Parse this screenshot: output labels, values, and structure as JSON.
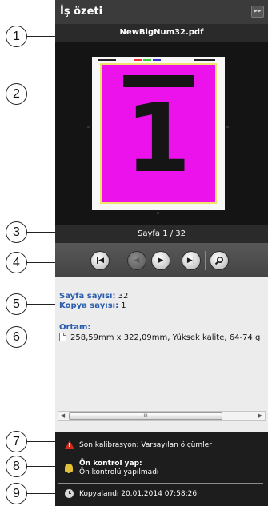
{
  "panel": {
    "title": "İş özeti",
    "collapse_glyph": "▸▸",
    "filename": "NewBigNum32.pdf",
    "preview_page_number": "1",
    "page_indicator": "Sayfa 1 / 32"
  },
  "nav": {
    "first_icon": "skip-to-first-icon",
    "prev_icon": "previous-page-icon",
    "next_icon": "next-page-icon",
    "last_icon": "skip-to-last-icon",
    "zoom_icon": "magnifier-icon"
  },
  "details": {
    "pages_label": "Sayfa sayısı:",
    "pages_value": "32",
    "copies_label": "Kopya sayısı:",
    "copies_value": "1",
    "media_label": "Ortam:",
    "media_value": "258,59mm x 322,09mm, Yüksek kalite, 64-74 g"
  },
  "scrollbar": {
    "grip": "III",
    "left_arrow": "◀",
    "right_arrow": "▶"
  },
  "status": {
    "calibration_text": "Son kalibrasyon: Varsayılan ölçümler",
    "preflight_title": "Ön kontrol yap:",
    "preflight_detail": "Ön kontrolü yapılmadı",
    "copied_text": "Kopyalandı 20.01.2014 07:58:26",
    "warning_glyph": "!"
  },
  "callouts": [
    "1",
    "2",
    "3",
    "4",
    "5",
    "6",
    "7",
    "8",
    "9"
  ],
  "colors": {
    "page_fill": "#ec12ec",
    "page_border": "#efe36a",
    "warning": "#d62a1e",
    "bell": "#e2c03a",
    "label_blue": "#2a5cae"
  }
}
